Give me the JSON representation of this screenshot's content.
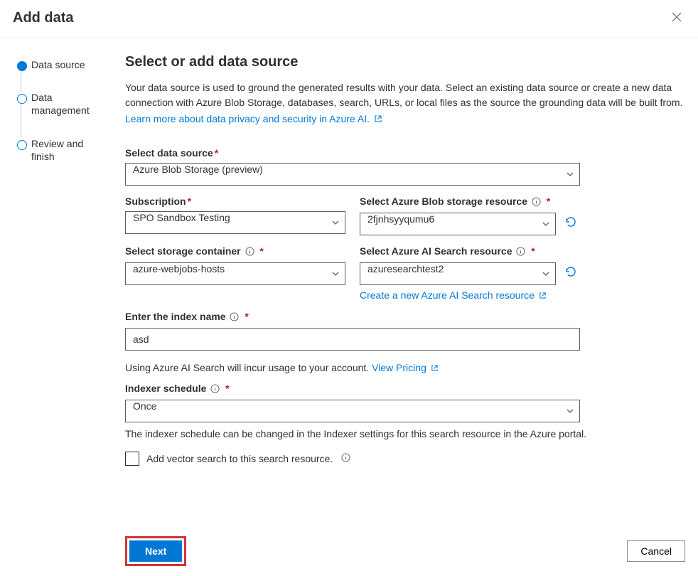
{
  "header": {
    "title": "Add data"
  },
  "sidebar": {
    "steps": [
      {
        "label": "Data source",
        "active": true
      },
      {
        "label": "Data management",
        "active": false
      },
      {
        "label": "Review and finish",
        "active": false
      }
    ]
  },
  "main": {
    "title": "Select or add data source",
    "description": "Your data source is used to ground the generated results with your data. Select an existing data source or create a new data connection with Azure Blob Storage, databases, search, URLs, or local files as the source the grounding data will be built from.",
    "privacy_link": "Learn more about data privacy and security in Azure AI.",
    "fields": {
      "data_source": {
        "label": "Select data source",
        "value": "Azure Blob Storage (preview)"
      },
      "subscription": {
        "label": "Subscription",
        "value": "SPO Sandbox Testing"
      },
      "blob_resource": {
        "label": "Select Azure Blob storage resource",
        "value": "2fjnhsyyqumu6"
      },
      "storage_container": {
        "label": "Select storage container",
        "value": "azure-webjobs-hosts"
      },
      "search_resource": {
        "label": "Select Azure AI Search resource",
        "value": "azuresearchtest2",
        "create_link": "Create a new Azure AI Search resource"
      },
      "index_name": {
        "label": "Enter the index name",
        "value": "asd"
      },
      "pricing": {
        "text": "Using Azure AI Search will incur usage to your account. ",
        "link": "View Pricing"
      },
      "indexer_schedule": {
        "label": "Indexer schedule",
        "value": "Once",
        "helper": "The indexer schedule can be changed in the Indexer settings for this search resource in the Azure portal."
      },
      "vector_search": {
        "label": "Add vector search to this search resource."
      }
    }
  },
  "footer": {
    "next": "Next",
    "cancel": "Cancel"
  }
}
